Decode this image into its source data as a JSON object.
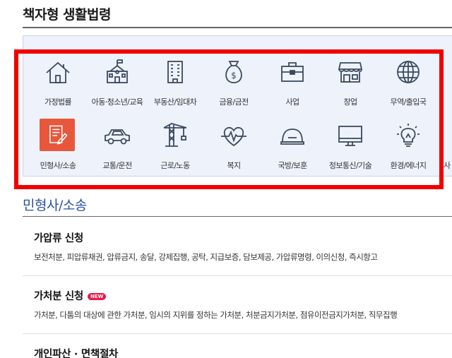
{
  "header": {
    "title": "책자형 생활법령"
  },
  "categories": [
    {
      "label": "가정법률",
      "icon": "house-icon"
    },
    {
      "label": "아동·청소년/교육",
      "icon": "school-icon"
    },
    {
      "label": "부동산/임대차",
      "icon": "building-icon"
    },
    {
      "label": "금융/금전",
      "icon": "money-bag-icon"
    },
    {
      "label": "사업",
      "icon": "briefcase-icon"
    },
    {
      "label": "창업",
      "icon": "store-icon"
    },
    {
      "label": "무역/출입국",
      "icon": "globe-icon"
    },
    {
      "label": "민형사/소송",
      "icon": "document-pen-icon",
      "active": true
    },
    {
      "label": "교통/운전",
      "icon": "car-icon"
    },
    {
      "label": "근로/노동",
      "icon": "crane-icon"
    },
    {
      "label": "복지",
      "icon": "heart-pulse-icon"
    },
    {
      "label": "국방/보훈",
      "icon": "helmet-icon"
    },
    {
      "label": "정보통신/기술",
      "icon": "monitor-icon"
    },
    {
      "label": "환경/에너지",
      "icon": "lightbulb-icon"
    },
    {
      "label": "사",
      "icon": ""
    }
  ],
  "section": {
    "title": "민형사/소송"
  },
  "items": [
    {
      "title": "가압류 신청",
      "desc": "보전처분, 피압류채권, 압류금지, 송달, 강제집행, 공탁, 지급보증, 담보제공, 가압류명령, 이의신청, 즉시항고",
      "badge": ""
    },
    {
      "title": "가처분 신청",
      "desc": "가처분, 다툼의 대상에 관한 가처분, 임시의 지위를 정하는 가처분, 처분금지가처분, 점유이전금지가처분, 직무집행",
      "badge": "NEW"
    },
    {
      "title": "개인파산 · 면책절차",
      "desc": "",
      "badge": ""
    }
  ],
  "colors": {
    "accent": "#e8573c",
    "highlight": "#f20000",
    "section_title": "#2b4f9e",
    "panel_bg": "#eef2fa"
  }
}
